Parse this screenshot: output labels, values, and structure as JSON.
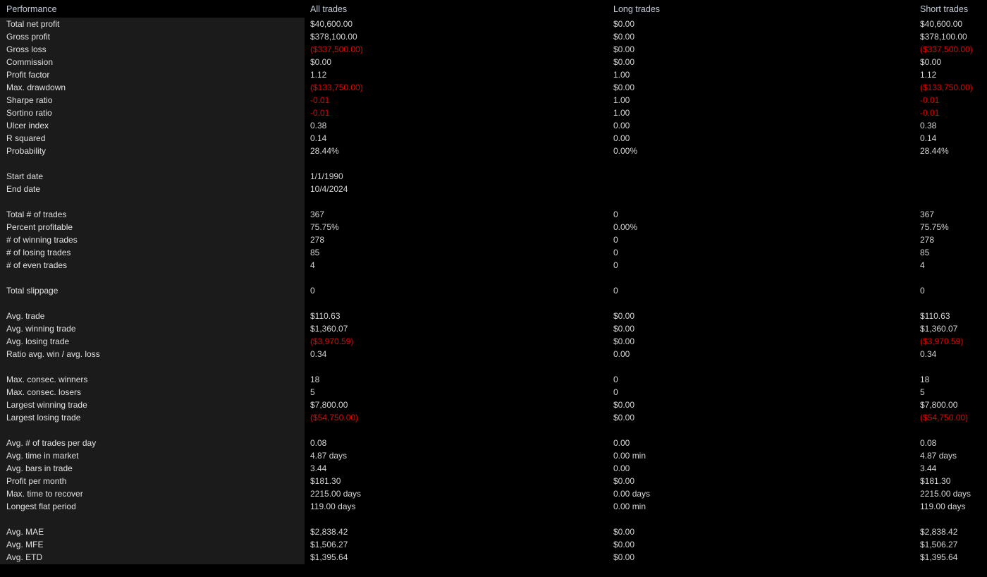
{
  "header": {
    "label_column": "Performance",
    "all_trades": "All trades",
    "long_trades": "Long trades",
    "short_trades": "Short trades"
  },
  "colors": {
    "negative": "#dd0606",
    "text": "#d6d6d6",
    "header_text": "#c3cbd8",
    "panel_background": "#1b1b1b",
    "page_background": "#000000"
  },
  "rows": [
    {
      "label": "Total net profit",
      "all": "$40,600.00",
      "long": "$0.00",
      "short": "$40,600.00"
    },
    {
      "label": "Gross profit",
      "all": "$378,100.00",
      "long": "$0.00",
      "short": "$378,100.00"
    },
    {
      "label": "Gross loss",
      "all": "($337,500.00)",
      "long": "$0.00",
      "short": "($337,500.00)",
      "all_neg": true,
      "short_neg": true
    },
    {
      "label": "Commission",
      "all": "$0.00",
      "long": "$0.00",
      "short": "$0.00"
    },
    {
      "label": "Profit factor",
      "all": "1.12",
      "long": "1.00",
      "short": "1.12"
    },
    {
      "label": "Max. drawdown",
      "all": "($133,750.00)",
      "long": "$0.00",
      "short": "($133,750.00)",
      "all_neg": true,
      "short_neg": true
    },
    {
      "label": "Sharpe ratio",
      "all": "-0.01",
      "long": "1.00",
      "short": "-0.01",
      "all_neg": true,
      "short_neg": true
    },
    {
      "label": "Sortino ratio",
      "all": "-0.01",
      "long": "1.00",
      "short": "-0.01",
      "all_neg": true,
      "short_neg": true
    },
    {
      "label": "Ulcer index",
      "all": "0.38",
      "long": "0.00",
      "short": "0.38"
    },
    {
      "label": "R squared",
      "all": "0.14",
      "long": "0.00",
      "short": "0.14"
    },
    {
      "label": "Probability",
      "all": "28.44%",
      "long": "0.00%",
      "short": "28.44%"
    },
    {
      "spacer": true
    },
    {
      "label": "Start date",
      "all": "1/1/1990",
      "long": "",
      "short": ""
    },
    {
      "label": "End date",
      "all": "10/4/2024",
      "long": "",
      "short": ""
    },
    {
      "spacer": true
    },
    {
      "label": "Total # of trades",
      "all": "367",
      "long": "0",
      "short": "367"
    },
    {
      "label": "Percent profitable",
      "all": "75.75%",
      "long": "0.00%",
      "short": "75.75%"
    },
    {
      "label": "# of winning trades",
      "all": "278",
      "long": "0",
      "short": "278"
    },
    {
      "label": "# of losing trades",
      "all": "85",
      "long": "0",
      "short": "85"
    },
    {
      "label": "# of even trades",
      "all": "4",
      "long": "0",
      "short": "4"
    },
    {
      "spacer": true
    },
    {
      "label": "Total slippage",
      "all": "0",
      "long": "0",
      "short": "0"
    },
    {
      "spacer": true
    },
    {
      "label": "Avg. trade",
      "all": "$110.63",
      "long": "$0.00",
      "short": "$110.63"
    },
    {
      "label": "Avg. winning trade",
      "all": "$1,360.07",
      "long": "$0.00",
      "short": "$1,360.07"
    },
    {
      "label": "Avg. losing trade",
      "all": "($3,970.59)",
      "long": "$0.00",
      "short": "($3,970.59)",
      "all_neg": true,
      "short_neg": true
    },
    {
      "label": "Ratio avg. win / avg. loss",
      "all": "0.34",
      "long": "0.00",
      "short": "0.34"
    },
    {
      "spacer": true
    },
    {
      "label": "Max. consec. winners",
      "all": "18",
      "long": "0",
      "short": "18"
    },
    {
      "label": "Max. consec. losers",
      "all": "5",
      "long": "0",
      "short": "5"
    },
    {
      "label": "Largest winning trade",
      "all": "$7,800.00",
      "long": "$0.00",
      "short": "$7,800.00"
    },
    {
      "label": "Largest losing trade",
      "all": "($54,750.00)",
      "long": "$0.00",
      "short": "($54,750.00)",
      "all_neg": true,
      "short_neg": true
    },
    {
      "spacer": true
    },
    {
      "label": "Avg. # of trades per day",
      "all": "0.08",
      "long": "0.00",
      "short": "0.08"
    },
    {
      "label": "Avg. time in market",
      "all": "4.87 days",
      "long": "0.00 min",
      "short": "4.87 days"
    },
    {
      "label": "Avg. bars in trade",
      "all": "3.44",
      "long": "0.00",
      "short": "3.44"
    },
    {
      "label": "Profit per month",
      "all": "$181.30",
      "long": "$0.00",
      "short": "$181.30"
    },
    {
      "label": "Max. time to recover",
      "all": "2215.00 days",
      "long": "0.00 days",
      "short": "2215.00 days"
    },
    {
      "label": "Longest flat period",
      "all": "119.00 days",
      "long": "0.00 min",
      "short": "119.00 days"
    },
    {
      "spacer": true
    },
    {
      "label": "Avg. MAE",
      "all": "$2,838.42",
      "long": "$0.00",
      "short": "$2,838.42"
    },
    {
      "label": "Avg. MFE",
      "all": "$1,506.27",
      "long": "$0.00",
      "short": "$1,506.27"
    },
    {
      "label": "Avg. ETD",
      "all": "$1,395.64",
      "long": "$0.00",
      "short": "$1,395.64"
    }
  ]
}
